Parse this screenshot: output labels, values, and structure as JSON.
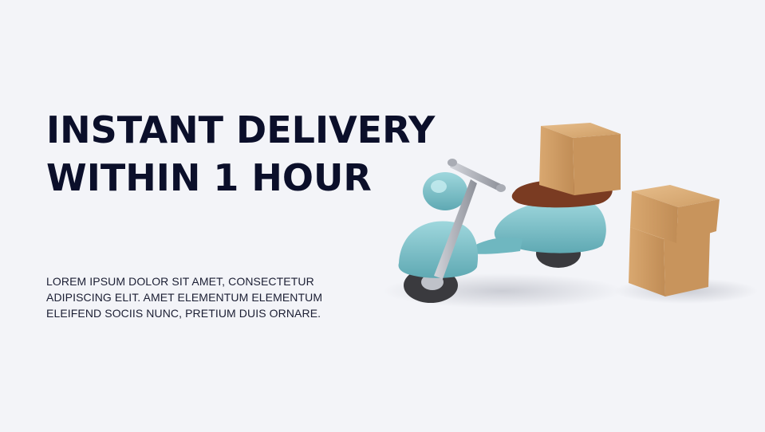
{
  "headline": {
    "line1": "INSTANT DELIVERY",
    "line2": "WITHIN 1 HOUR"
  },
  "body": {
    "text": "LOREM IPSUM DOLOR SIT AMET, CONSECTETUR ADIPISCING ELIT. AMET ELEMENTUM ELEMENTUM ELEIFEND SOCIIS NUNC, PRETIUM DUIS ORNARE."
  },
  "colors": {
    "background": "#f3f4f8",
    "headline": "#0b0f2a",
    "scooter_body": "#7fc4cc",
    "seat": "#7a3b22",
    "box": "#d6a56f"
  },
  "illustration": {
    "icon": "delivery-scooter-with-boxes-icon"
  }
}
